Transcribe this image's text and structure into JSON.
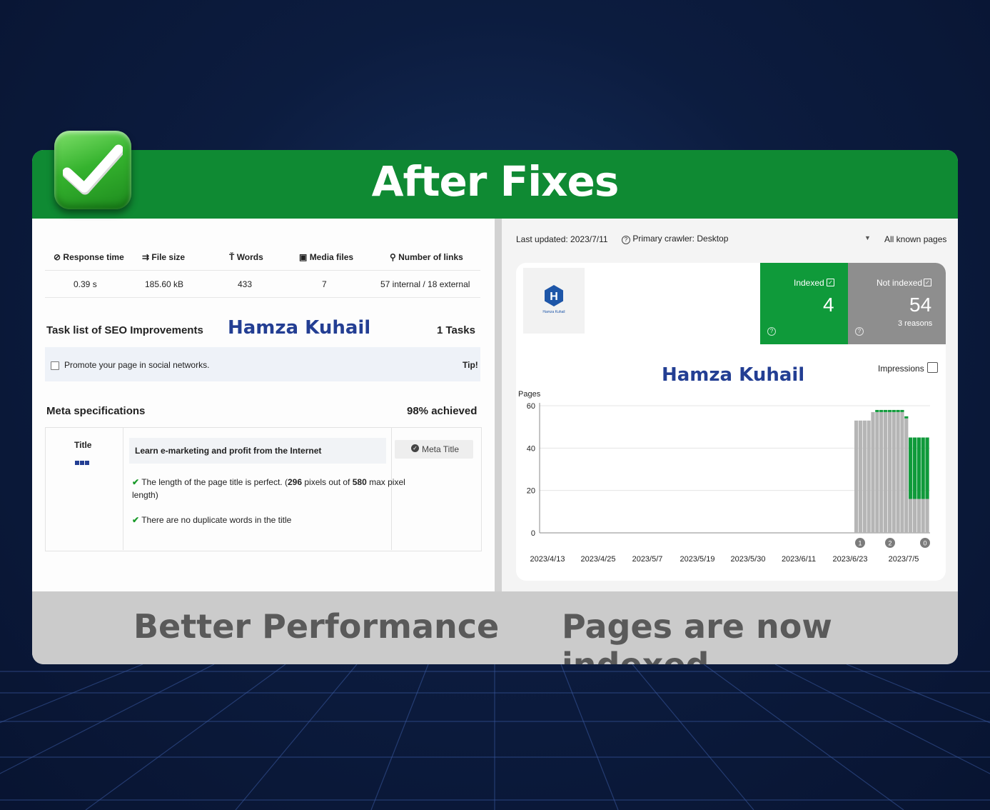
{
  "banner": {
    "title": "After Fixes"
  },
  "footer": {
    "left": "Better Performance",
    "right": "Pages are now indexed"
  },
  "left_panel": {
    "stats_headers": [
      "Response time",
      "File size",
      "Words",
      "Media files",
      "Number of links"
    ],
    "stats_values": [
      "0.39 s",
      "185.60 kB",
      "433",
      "7",
      "57 internal / 18 external"
    ],
    "task_title": "Task list of SEO Improvements",
    "watermark": "Hamza Kuhail",
    "task_count": "1 Tasks",
    "task_item": "Promote your page in social networks.",
    "task_tip": "Tip!",
    "meta_title": "Meta specifications",
    "meta_score": "98% achieved",
    "title_label": "Title",
    "title_value": "Learn e-marketing and profit from the Internet",
    "meta_button": "Meta Title",
    "check1_a": "The length of the page title is perfect. (",
    "check1_b": "296",
    "check1_c": " pixels out of ",
    "check1_d": "580",
    "check1_e": " max pixel",
    "check1_f": "length)",
    "check2": "There are no duplicate words in the title"
  },
  "right_panel": {
    "last_updated": "Last updated: 2023/7/11",
    "crawler": "Primary crawler: Desktop",
    "scope": "All known pages",
    "indexed_label": "Indexed",
    "indexed_value": "4",
    "not_indexed_label": "Not indexed",
    "not_indexed_value": "54",
    "reasons": "3 reasons",
    "watermark": "Hamza Kuhail",
    "impressions_label": "Impressions",
    "logo_caption": "Hamza Kuhail"
  },
  "chart_data": {
    "type": "bar",
    "ylabel": "Pages",
    "ylim": [
      0,
      60
    ],
    "yticks": [
      0,
      20,
      40,
      60
    ],
    "xtick_labels": [
      "2023/4/13",
      "2023/4/25",
      "2023/5/7",
      "2023/5/19",
      "2023/5/30",
      "2023/6/11",
      "2023/6/23",
      "2023/7/5"
    ],
    "series": [
      {
        "name": "Not indexed",
        "color": "#b5b5b5",
        "values": [
          53,
          53,
          53,
          53,
          57,
          57,
          57,
          57,
          57,
          57,
          57,
          57,
          54,
          16,
          16,
          16,
          16,
          16
        ]
      },
      {
        "name": "Indexed",
        "color": "#0f9a3a",
        "values": [
          0,
          0,
          0,
          0,
          0,
          1,
          1,
          1,
          1,
          1,
          1,
          1,
          1,
          29,
          29,
          29,
          29,
          29
        ]
      }
    ],
    "annotations": [
      "1",
      "2",
      "0"
    ]
  }
}
